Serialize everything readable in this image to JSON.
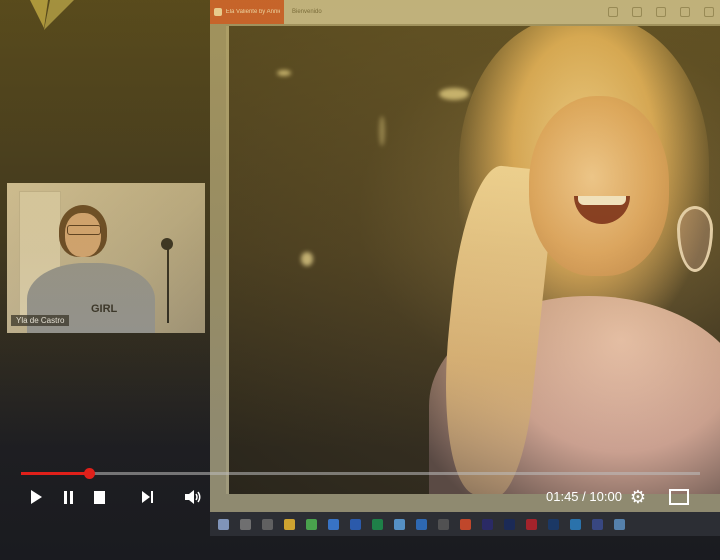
{
  "browser": {
    "active_tab": "Ela Valiente by Annie",
    "tab2": "Bienvenido"
  },
  "webcam": {
    "participant_name": "Yla de Castro",
    "shirt_text": "GIRL"
  },
  "player": {
    "progress_fraction": 0.1,
    "current_time": "01:45",
    "duration": "10:00",
    "time_separator": " / ",
    "accent_color": "#e0201a"
  },
  "icons": {
    "play": "play-icon",
    "pause": "pause-icon",
    "stop": "stop-icon",
    "next": "skip-next-icon",
    "volume": "volume-icon",
    "settings": "gear-icon",
    "fullscreen": "fullscreen-icon"
  }
}
